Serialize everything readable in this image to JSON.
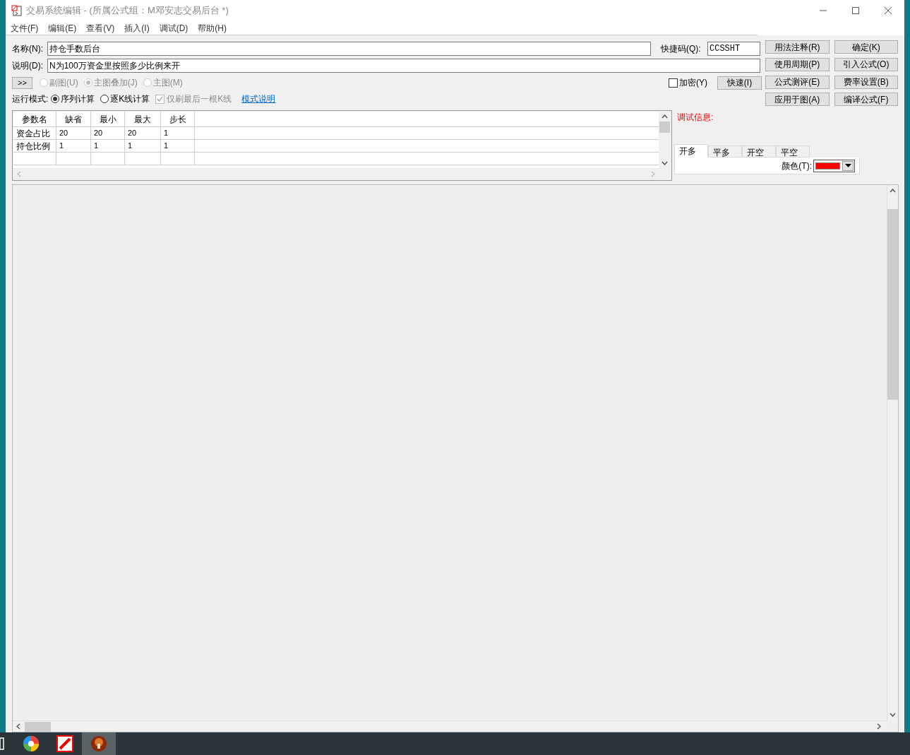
{
  "window": {
    "title": "交易系统编辑 - (所属公式组：M邓安志交易后台 *)"
  },
  "menu": [
    "文件(F)",
    "编辑(E)",
    "查看(V)",
    "插入(I)",
    "调试(D)",
    "帮助(H)"
  ],
  "name": {
    "label": "名称(N):",
    "value": "持仓手数后台"
  },
  "shortcut": {
    "label": "快捷码(Q):",
    "value": "CCSSHT"
  },
  "description": {
    "label": "说明(D):",
    "value": "N为100万资金里按照多少比例来开"
  },
  "expand_button": ">>",
  "chart_types": [
    {
      "label": "副图(U)",
      "selected": false,
      "disabled": true
    },
    {
      "label": "主图叠加(J)",
      "selected": true,
      "disabled": true
    },
    {
      "label": "主图(M)",
      "selected": false,
      "disabled": true
    }
  ],
  "encrypt": {
    "label": "加密(Y)",
    "checked": false
  },
  "fast_button": "快速(I)",
  "run_mode": {
    "label": "运行模式:",
    "options": [
      {
        "label": "序列计算",
        "selected": true
      },
      {
        "label": "逐K线计算",
        "selected": false
      }
    ]
  },
  "refresh_last": {
    "label": "仅刷最后一根K线",
    "checked": true,
    "disabled": true
  },
  "mode_link": "模式说明",
  "buttons": [
    [
      "用法注释(R)",
      "确定(K)"
    ],
    [
      "使用周期(P)",
      "引入公式(O)"
    ],
    [
      "公式测评(E)",
      "费率设置(B)"
    ],
    [
      "应用于图(A)",
      "编译公式(F)"
    ]
  ],
  "params": {
    "columns": [
      "参数名",
      "缺省",
      "最小",
      "最大",
      "步长"
    ],
    "rows": [
      [
        "资金占比",
        "20",
        "20",
        "20",
        "1"
      ],
      [
        "持仓比例",
        "1",
        "1",
        "1",
        "1"
      ]
    ]
  },
  "debug_label": "调试信息:",
  "signal_tabs": [
    {
      "label": "开多",
      "selected": true
    },
    {
      "label": "平多",
      "selected": false
    },
    {
      "label": "开空",
      "selected": false
    },
    {
      "label": "平空",
      "selected": false
    }
  ],
  "color": {
    "label": "颜色(T):",
    "color": "#ff0000"
  }
}
